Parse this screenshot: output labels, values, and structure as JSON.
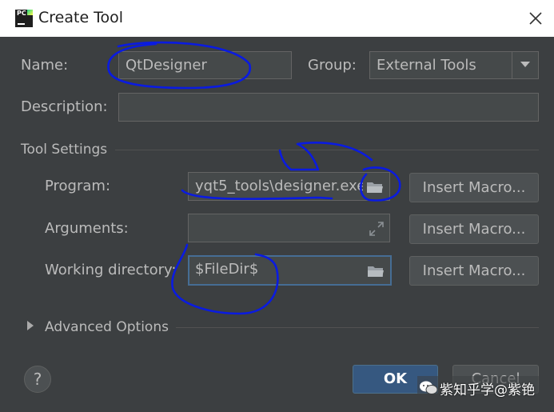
{
  "window": {
    "title": "Create Tool",
    "app_icon_text": "PC"
  },
  "form": {
    "name_label": "Name:",
    "name_value": "QtDesigner",
    "group_label": "Group:",
    "group_value": "External Tools",
    "description_label": "Description:",
    "description_value": ""
  },
  "tool_settings": {
    "section_title": "Tool Settings",
    "program_label": "Program:",
    "program_value": "yqt5_tools\\designer.exe",
    "arguments_label": "Arguments:",
    "arguments_value": "",
    "working_dir_label": "Working directory:",
    "working_dir_value": "$FileDir$",
    "insert_macro_label": "Insert Macro..."
  },
  "advanced": {
    "label": "Advanced Options"
  },
  "footer": {
    "help_label": "?",
    "ok_label": "OK",
    "cancel_label": "Cancel"
  },
  "watermark": {
    "text": "紫知乎学@紫铯"
  },
  "colors": {
    "background": "#3c3f41",
    "field": "#45494a",
    "ok_button": "#365880",
    "annotation": "#0a1be0"
  },
  "icons": {
    "close": "close-icon",
    "dropdown": "chevron-down-icon",
    "folder": "folder-icon",
    "expand": "expand-icon",
    "wechat": "wechat-icon"
  }
}
